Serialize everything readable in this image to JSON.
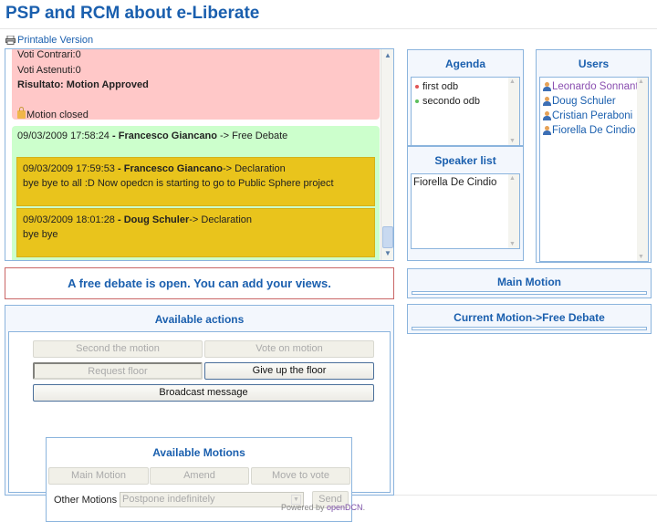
{
  "page": {
    "title": "PSP and RCM about e-Liberate",
    "printable_label": "Printable Version"
  },
  "log": {
    "vote_result": {
      "voti_contrari": "Voti Contrari:0",
      "voti_astenuti": "Voti Astenuti:0",
      "risultato": "Risultato: Motion Approved",
      "closed": "Motion closed"
    },
    "free_debate": {
      "timestamp": "09/03/2009 17:58:24",
      "sep": " - ",
      "author": "Francesco Giancano",
      "action": " -> Free Debate"
    },
    "declarations": [
      {
        "timestamp": "09/03/2009 17:59:53",
        "sep": " - ",
        "author": "Francesco Giancano",
        "action": "-> Declaration",
        "text": "bye bye to all :D Now opedcn is starting to go to Public Sphere project"
      },
      {
        "timestamp": "09/03/2009 18:01:28",
        "sep": " - ",
        "author": "Doug Schuler",
        "action": "-> Declaration",
        "text": "bye bye"
      }
    ]
  },
  "agenda": {
    "title": "Agenda",
    "items": [
      {
        "label": "first odb",
        "status_color": "#e05555"
      },
      {
        "label": "secondo odb",
        "status_color": "#5cbf5c"
      }
    ]
  },
  "speaker_list": {
    "title": "Speaker list",
    "items": [
      "Fiorella De Cindio"
    ]
  },
  "users": {
    "title": "Users",
    "items": [
      {
        "name": "Leonardo Sonnante",
        "color": "#8a4fb0"
      },
      {
        "name": "Doug Schuler",
        "color": "#1a5fae"
      },
      {
        "name": "Cristian Peraboni",
        "color": "#1a5fae"
      },
      {
        "name": "Fiorella De Cindio",
        "color": "#1a5fae"
      }
    ]
  },
  "notice": "A free debate is open. You can add your views.",
  "main_motion": {
    "title": "Main Motion"
  },
  "current_motion": {
    "title": "Current Motion->Free Debate"
  },
  "actions": {
    "title": "Available actions",
    "second_motion": "Second the motion",
    "vote_on_motion": "Vote on motion",
    "request_floor": "Request floor",
    "give_up_floor": "Give up the floor",
    "broadcast": "Broadcast message"
  },
  "motions": {
    "title": "Available Motions",
    "main_motion": "Main Motion",
    "amend": "Amend",
    "move_to_vote": "Move to vote",
    "other_label": "Other Motions",
    "other_selected": "Postpone indefinitely",
    "send": "Send"
  },
  "footer": {
    "prefix": "Powered by ",
    "link": "openDCN",
    "suffix": "."
  },
  "colors": {
    "accent": "#1a5fae",
    "vote_card": "#ffc8c8",
    "debate_card": "#ccffcc",
    "declaration": "#e9c41c"
  }
}
